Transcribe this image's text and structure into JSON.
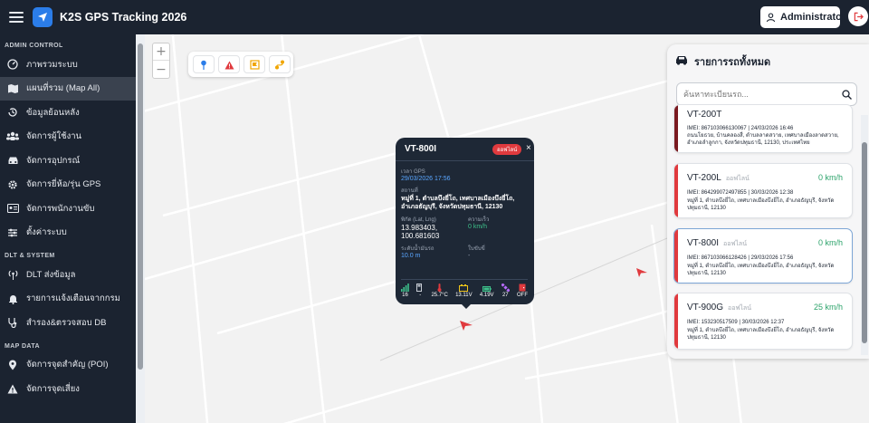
{
  "header": {
    "title": "K2S GPS Tracking 2026",
    "user": "Administrator"
  },
  "sidebar": {
    "sections": [
      {
        "title": "ADMIN CONTROL",
        "items": [
          {
            "label": "ภาพรวมระบบ",
            "icon": "dashboard-icon"
          },
          {
            "label": "แผนที่รวม (Map All)",
            "icon": "map-icon",
            "active": true
          },
          {
            "label": "ข้อมูลย้อนหลัง",
            "icon": "history-icon"
          },
          {
            "label": "จัดการผู้ใช้งาน",
            "icon": "users-icon"
          },
          {
            "label": "จัดการอุปกรณ์",
            "icon": "car-icon"
          },
          {
            "label": "จัดการยี่ห้อ/รุ่น GPS",
            "icon": "gear-icon"
          },
          {
            "label": "จัดการพนักงานขับ",
            "icon": "id-card-icon"
          },
          {
            "label": "ตั้งค่าระบบ",
            "icon": "sliders-icon"
          }
        ]
      },
      {
        "title": "DLT & SYSTEM",
        "items": [
          {
            "label": "DLT ส่งข้อมูล",
            "icon": "broadcast-icon"
          },
          {
            "label": "รายการแจ้งเตือนจากกรม",
            "icon": "bell-icon"
          },
          {
            "label": "สำรอง&ตรวจสอบ DB",
            "icon": "stethoscope-icon"
          }
        ]
      },
      {
        "title": "MAP DATA",
        "items": [
          {
            "label": "จัดการจุดสำคัญ (POI)",
            "icon": "pin-icon"
          },
          {
            "label": "จัดการจุดเสี่ยง",
            "icon": "warning-icon"
          }
        ]
      }
    ]
  },
  "map": {
    "zoom_in": "+",
    "zoom_out": "−"
  },
  "popup": {
    "title": "VT-800I",
    "status": "ออฟไลน์",
    "close": "×",
    "gps_time_label": "เวลา GPS",
    "gps_time": "29/03/2026 17:56",
    "location_label": "สถานที่",
    "location": "หมู่ที่ 1, ตำบลบึงยี่โถ, เทศบาลเมืองบึงยี่โถ, อำเภอธัญบุรี, จังหวัดปทุมธานี, 12130",
    "coord_label": "พิกัด (Lat, Lng)",
    "coord": "13.983403, 100.681603",
    "speed_label": "ความเร็ว",
    "speed": "0 km/h",
    "fuel_label": "ระดับน้ำมันรถ",
    "fuel": "10.0 m",
    "license_label": "ใบขับขี่",
    "license": "-",
    "sensors": [
      {
        "name": "signal-icon",
        "value": "16"
      },
      {
        "name": "fuel-pump-icon",
        "value": "-"
      },
      {
        "name": "thermometer-icon",
        "value": "25.7°C"
      },
      {
        "name": "car-battery-icon",
        "value": "13.11V"
      },
      {
        "name": "battery-icon",
        "value": "4.19V"
      },
      {
        "name": "satellite-icon",
        "value": "27"
      },
      {
        "name": "door-icon",
        "value": "OFF"
      }
    ]
  },
  "panel": {
    "title": "รายการรถทั้งหมด",
    "search_placeholder": "ค้นหาทะเบียนรถ...",
    "cards": [
      {
        "name": "VT-200T",
        "status": "",
        "speed": "",
        "imei": "IMEI: 867103066130067 | 24/03/2026 16:46",
        "addr": "ถนนโยธวย, บ้านคลองสี่, ตำบลลาดสวาย, เทศบาลเมืองลาดสวาย, อำเภอลำลูกกา, จังหวัดปทุมธานี, 12130, ประเทศไทย"
      },
      {
        "name": "VT-200L",
        "status": "ออฟไลน์",
        "speed": "0 km/h",
        "imei": "IMEI: 864299072497855 | 30/03/2026 12:38",
        "addr": "หมู่ที่ 1, ตำบลบึงยี่โถ, เทศบาลเมืองบึงยี่โถ, อำเภอธัญบุรี, จังหวัดปทุมธานี, 12130"
      },
      {
        "name": "VT-800I",
        "status": "ออฟไลน์",
        "speed": "0 km/h",
        "imei": "IMEI: 867103066128426 | 29/03/2026 17:56",
        "addr": "หมู่ที่ 1, ตำบลบึงยี่โถ, เทศบาลเมืองบึงยี่โถ, อำเภอธัญบุรี, จังหวัดปทุมธานี, 12130"
      },
      {
        "name": "VT-900G",
        "status": "ออฟไลน์",
        "speed": "25 km/h",
        "imei": "IMEI: 153230517509 | 30/03/2026 12:37",
        "addr": "หมู่ที่ 1, ตำบลบึงยี่โถ, เทศบาลเมืองบึงยี่โถ, อำเภอธัญบุรี, จังหวัดปทุมธานี, 12130"
      }
    ]
  },
  "colors": {
    "topbar": "#1b2330",
    "accent": "#2b7de9",
    "offline": "#e03a3e",
    "speed": "#2da36b"
  }
}
